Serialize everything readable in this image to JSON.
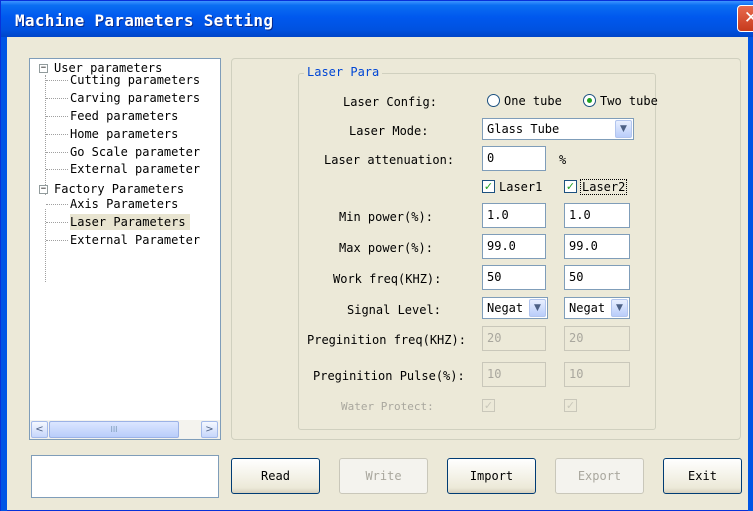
{
  "window": {
    "title": "Machine Parameters Setting",
    "close_glyph": "✕"
  },
  "tree": {
    "groups": [
      {
        "label": "User parameters",
        "expander": "−",
        "children": [
          "Cutting parameters",
          "Carving parameters",
          "Feed parameters",
          "Home parameters",
          "Go Scale parameter",
          "External parameter"
        ]
      },
      {
        "label": "Factory Parameters",
        "expander": "−",
        "children": [
          "Axis Parameters",
          "Laser Parameters",
          "External Parameter"
        ]
      }
    ],
    "selected": "Laser Parameters",
    "scroll_left": "<",
    "scroll_right": ">",
    "thumb_grip": "III"
  },
  "laser_para": {
    "group_title": "Laser Para",
    "config": {
      "label": "Laser Config:",
      "options": [
        "One tube",
        "Two tube"
      ],
      "selected": "Two tube"
    },
    "mode": {
      "label": "Laser Mode:",
      "value": "Glass Tube"
    },
    "attenuation": {
      "label": "Laser attenuation:",
      "value": "0",
      "unit": "%"
    },
    "laser1": {
      "label": "Laser1",
      "checked": true
    },
    "laser2": {
      "label": "Laser2",
      "checked": true
    },
    "min_power": {
      "label": "Min power(%):",
      "laser1": "1.0",
      "laser2": "1.0"
    },
    "max_power": {
      "label": "Max power(%):",
      "laser1": "99.0",
      "laser2": "99.0"
    },
    "work_freq": {
      "label": "Work freq(KHZ):",
      "laser1": "50",
      "laser2": "50"
    },
    "signal_level": {
      "label": "Signal Level:",
      "laser1": "Negat",
      "laser2": "Negat"
    },
    "pregin_freq": {
      "label": "Preginition freq(KHZ):",
      "laser1": "20",
      "laser2": "20"
    },
    "pregin_pulse": {
      "label": "Preginition Pulse(%):",
      "laser1": "10",
      "laser2": "10"
    },
    "water_protect": {
      "label": "Water Protect:"
    }
  },
  "buttons": {
    "read": "Read",
    "write": "Write",
    "import": "Import",
    "export": "Export",
    "exit": "Exit"
  },
  "glyphs": {
    "check": "✓",
    "dropdown": "▼"
  }
}
